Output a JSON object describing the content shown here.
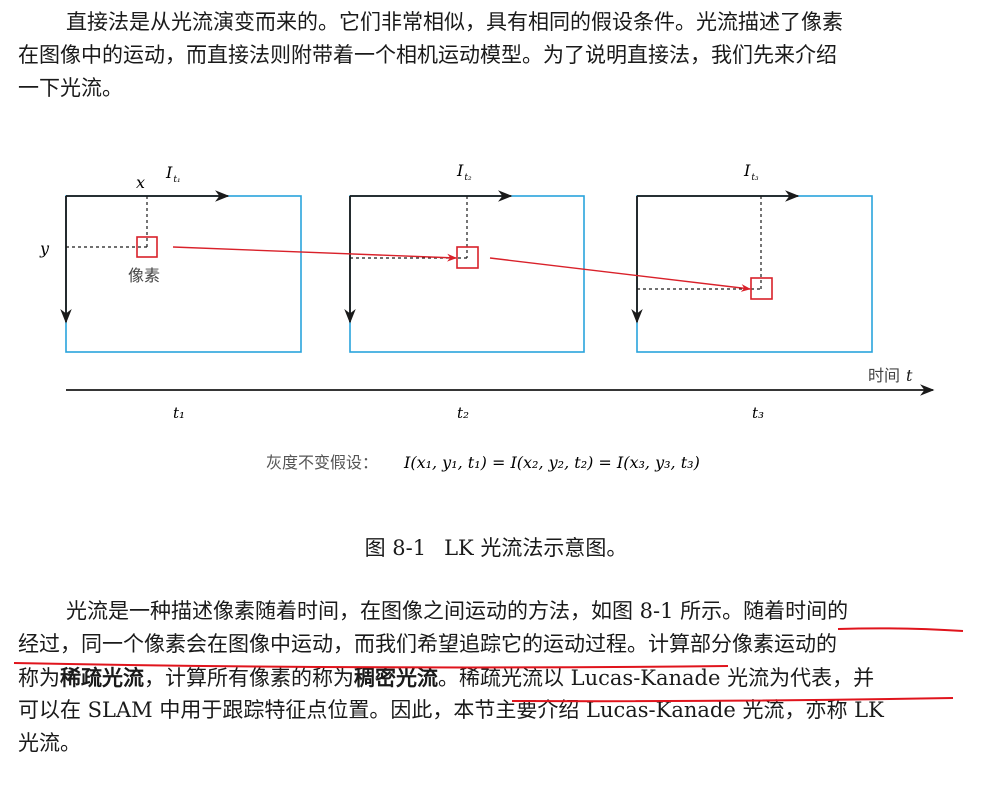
{
  "intro": {
    "lines": [
      "直接法是从光流演变而来的。它们非常相似，具有相同的假设条件。光流描述了像素",
      "在图像中的运动，而直接法则附带着一个相机运动模型。为了说明直接法，我们先来介绍",
      "一下光流。"
    ]
  },
  "figure": {
    "frame_labels": [
      "I",
      "I",
      "I"
    ],
    "frame_subscripts": [
      "t₁",
      "t₂",
      "t₃"
    ],
    "axis_x_label": "x",
    "axis_y_label": "y",
    "pixel_label": "像素",
    "time_label": "时间",
    "time_var": "t",
    "time_ticks": [
      "t₁",
      "t₂",
      "t₃"
    ],
    "assumption_label": "灰度不变假设：",
    "assumption_formula": "I(x₁, y₁, t₁) = I(x₂, y₂, t₂) = I(x₃, y₃, t₃)",
    "colors": {
      "frame_border": "#29a3dc",
      "arrow": "#d9212a",
      "axis": "#1a1a1a"
    }
  },
  "caption": {
    "number": "图 8-1",
    "text": "LK 光流法示意图。"
  },
  "body": {
    "l1_a": "光流是一种描述像素随着时间，在图像之间运动的方法，如图 8-1 所示。",
    "l1_b": "随着时间的",
    "l2_a": "经过，同一个像素会在图像中运动，而我们希望追踪它的运动过程。",
    "l2_b": "计算部分像素运动的",
    "l3_a": "称为",
    "l3_bold1": "稀疏光流",
    "l3_b": "，计算所有像素的称为",
    "l3_bold2": "稠密光流",
    "l3_c": "。",
    "l3_d": "稀疏光流以 Lucas-Kanade 光流为代表，并",
    "l4": "可以在 SLAM 中用于跟踪特征点位置。因此，本节主要介绍 Lucas-Kanade 光流，亦称 LK",
    "l5": "光流。"
  },
  "annotation": {
    "underline_color": "#e0141c"
  }
}
